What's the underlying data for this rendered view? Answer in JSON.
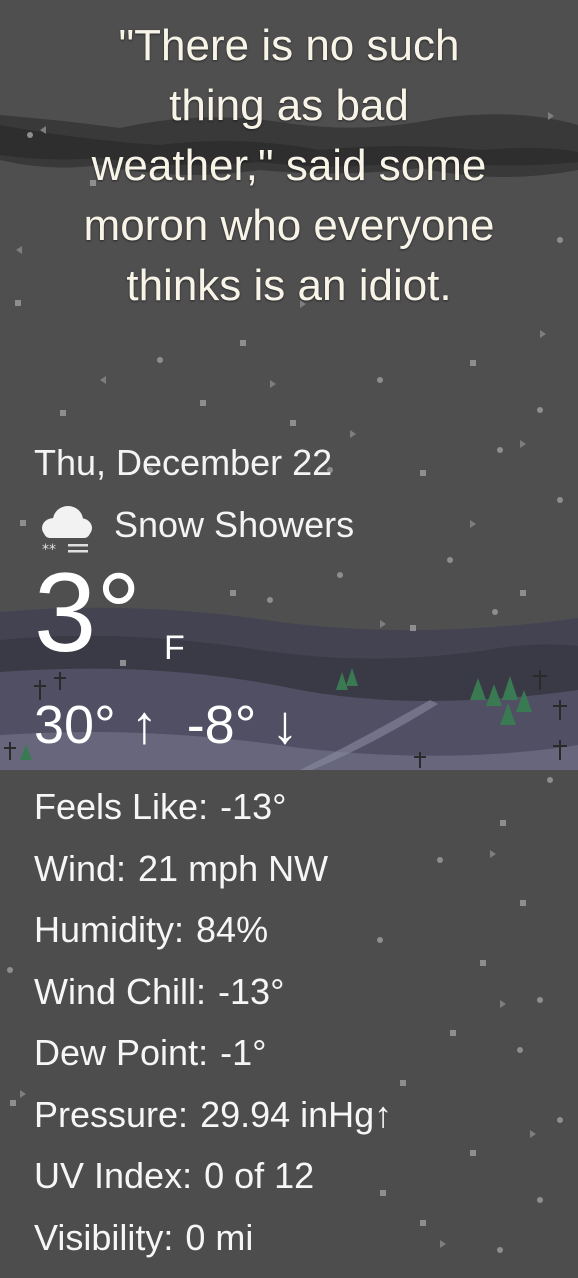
{
  "quote": {
    "lines": [
      "\"There is no such",
      "thing as bad",
      "weather,\" said some",
      "moron who everyone",
      "thinks is an idiot."
    ]
  },
  "date": "Thu, December 22",
  "condition": {
    "icon": "snow-showers-icon",
    "text": "Snow Showers"
  },
  "temperature": {
    "value": "3°",
    "unit": "F"
  },
  "high_low": {
    "high": "30°",
    "high_arrow": "↑",
    "low": "-8°",
    "low_arrow": "↓"
  },
  "details": [
    {
      "label": "Feels Like:",
      "value": "-13°"
    },
    {
      "label": "Wind:",
      "value": "21 mph NW"
    },
    {
      "label": "Humidity:",
      "value": "84%"
    },
    {
      "label": "Wind Chill:",
      "value": "-13°"
    },
    {
      "label": "Dew Point:",
      "value": "-1°"
    },
    {
      "label": "Pressure:",
      "value": "29.94 inHg↑"
    },
    {
      "label": "UV Index:",
      "value": "0 of 12"
    },
    {
      "label": "Visibility:",
      "value": "0 mi"
    }
  ],
  "colors": {
    "background": "#4e4e4f",
    "text": "#ffffff",
    "quote_text": "#f8f4e8",
    "hills": "#3e3c4a",
    "hills_light": "#6c6a80",
    "trees": "#3a7a52"
  }
}
